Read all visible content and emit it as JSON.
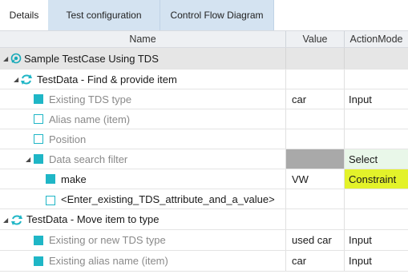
{
  "tabs": [
    {
      "label": "Details",
      "active": true
    },
    {
      "label": "Test configuration",
      "active": false
    },
    {
      "label": "Control Flow Diagram",
      "active": false
    }
  ],
  "columns": {
    "name": "Name",
    "value": "Value",
    "action_mode": "ActionMode"
  },
  "colors": {
    "accent": "#1fb6c6",
    "select_bg": "#e9f7e9",
    "constraint_bg": "#e3f22a",
    "gray_value": "#a9a9a9",
    "group_row": "#e6e6e6"
  },
  "rows": [
    {
      "name": "Sample TestCase Using TDS",
      "value": "",
      "mode": "",
      "type": "testcase"
    },
    {
      "name": "TestData - Find & provide item",
      "value": "",
      "mode": "",
      "type": "module"
    },
    {
      "name": "Existing TDS type",
      "value": "car",
      "mode": "Input",
      "type": "attr"
    },
    {
      "name": "Alias name (item)",
      "value": "",
      "mode": "",
      "type": "attr-empty"
    },
    {
      "name": "Position",
      "value": "",
      "mode": "",
      "type": "attr-empty"
    },
    {
      "name": "Data search filter",
      "value": "",
      "mode": "Select",
      "type": "filter"
    },
    {
      "name": "make",
      "value": "VW",
      "mode": "Constraint",
      "type": "sub"
    },
    {
      "name": "<Enter_existing_TDS_attribute_and_a_value>",
      "value": "",
      "mode": "",
      "type": "sub-empty"
    },
    {
      "name": "TestData - Move item to type",
      "value": "",
      "mode": "",
      "type": "module"
    },
    {
      "name": "Existing or new TDS type",
      "value": "used car",
      "mode": "Input",
      "type": "attr"
    },
    {
      "name": "Existing alias name (item)",
      "value": "car",
      "mode": "Input",
      "type": "attr"
    }
  ]
}
